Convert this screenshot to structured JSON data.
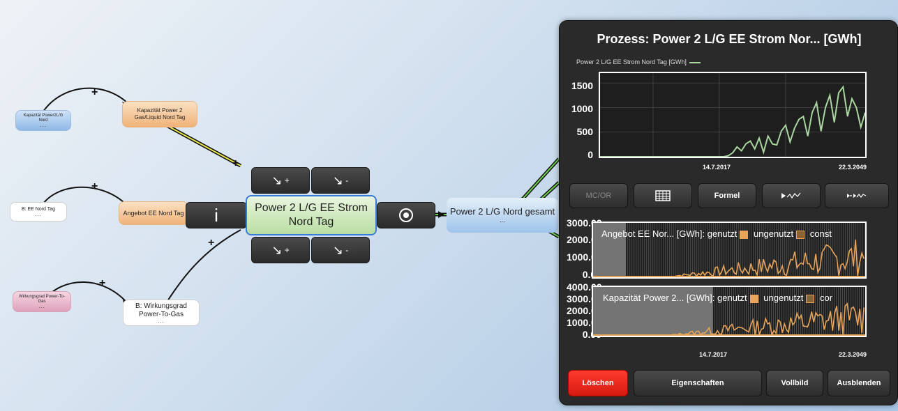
{
  "nodes": {
    "kapazitaet_source": {
      "label": "Kapazität Power2L/G Nord",
      "dots": "..."
    },
    "kapazitaet": {
      "label": "Kapazität Power 2 Gas/Liquid Nord Tag"
    },
    "ee_nord": {
      "label": "B: EE Nord Tag",
      "dots": "..."
    },
    "angebot": {
      "label": "Angebot EE Nord Tag"
    },
    "wirkungsgrad_source": {
      "label": "Wirkungsgrad Power-To-Gas",
      "dots": "..."
    },
    "wirkungsgrad": {
      "label": "B: Wirkungsgrad Power-To-Gas",
      "dots": "..."
    },
    "main": {
      "label": "Power 2 L/G EE Strom Nord Tag"
    },
    "output": {
      "label": "Power 2 L/G Nord gesamt",
      "dots": "..."
    }
  },
  "link_signs": {
    "plus": "+"
  },
  "controls": {
    "info": "i",
    "inc_plus": "+",
    "dec_minus": "-"
  },
  "panel": {
    "title": "Prozess: Power 2 L/G EE Strom Nor... [GWh]",
    "chart1_legend": "Power 2 L/G EE Strom Nord Tag [GWh]",
    "tool_buttons": [
      "MC/OR",
      "",
      "Formel",
      "",
      ""
    ],
    "chart2_legend": {
      "name": "Angebot EE Nor... [GWh]: genutzt",
      "b": "ungenutzt",
      "c": "const"
    },
    "chart3_legend": {
      "name": "Kapazität Power 2... [GWh]: genutzt",
      "b": "ungenutzt",
      "c": "cor"
    },
    "buttons": {
      "delete": "Löschen",
      "properties": "Eigenschaften",
      "fullscreen": "Vollbild",
      "hide": "Ausblenden"
    }
  },
  "chart_data": [
    {
      "type": "line",
      "title": "Power 2 L/G EE Strom Nord Tag [GWh]",
      "yticks": [
        "1500",
        "1000",
        "500",
        "0"
      ],
      "ylim": [
        0,
        1700
      ],
      "xticks": [
        "14.7.2017",
        "22.3.2049"
      ],
      "series": [
        {
          "name": "Power 2 L/G EE Strom Nord Tag [GWh]",
          "color": "#aad6a0",
          "values": [
            0,
            0,
            0,
            0,
            0,
            0,
            0,
            0,
            0,
            0,
            0,
            0,
            0,
            0,
            0,
            0,
            0,
            0,
            0,
            0,
            0,
            0,
            0,
            0,
            0,
            0,
            0,
            0,
            0,
            20,
            80,
            200,
            120,
            260,
            320,
            160,
            380,
            90,
            420,
            260,
            240,
            520,
            640,
            300,
            580,
            760,
            820,
            420,
            900,
            1100,
            520,
            1000,
            1250,
            700,
            1300,
            1420,
            820,
            1180,
            1000,
            600,
            900
          ]
        }
      ],
      "grid": true
    },
    {
      "type": "area",
      "title": "Angebot EE Nor... [GWh]: genutzt / ungenutzt / const",
      "yticks": [
        "3000.00",
        "2000.00",
        "1000.00",
        "0.00"
      ],
      "ylim": [
        0,
        3000
      ],
      "series": [
        {
          "name": "genutzt",
          "color": "#e9a55a"
        },
        {
          "name": "ungenutzt",
          "color": "#c98a3e"
        },
        {
          "name": "const",
          "color": "#888888"
        }
      ]
    },
    {
      "type": "area",
      "title": "Kapazität Power 2... [GWh]: genutzt / ungenutzt / cor",
      "yticks": [
        "4000.00",
        "3000.00",
        "2000.00",
        "1000.00",
        "0.00"
      ],
      "ylim": [
        0,
        4000
      ],
      "xticks": [
        "14.7.2017",
        "22.3.2049"
      ],
      "series": [
        {
          "name": "genutzt",
          "color": "#e9a55a"
        },
        {
          "name": "ungenutzt",
          "color": "#c98a3e"
        },
        {
          "name": "cor",
          "color": "#888888"
        }
      ]
    }
  ]
}
